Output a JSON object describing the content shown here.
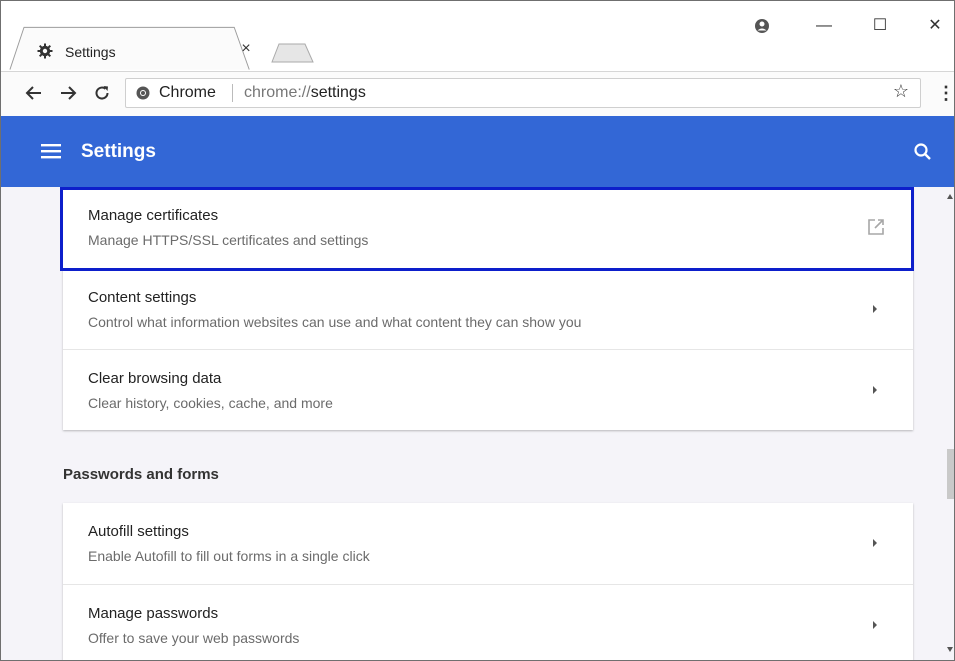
{
  "browser": {
    "tab": {
      "title": "Settings",
      "icon": "gear-icon",
      "close_label": "×"
    },
    "window_controls": {
      "profile_icon": "profile-icon",
      "minimize": "—",
      "maximize": "☐",
      "close": "✕"
    },
    "toolbar": {
      "back_icon": "back-arrow-icon",
      "forward_icon": "forward-arrow-icon",
      "reload_icon": "reload-icon",
      "omnibox": {
        "chip_label": "Chrome",
        "url_scheme": "chrome://",
        "url_path": "settings"
      },
      "bookmark_icon": "star-icon",
      "menu_icon": "more-vert-icon"
    }
  },
  "app": {
    "header": {
      "title": "Settings",
      "menu_icon": "hamburger-icon",
      "search_icon": "search-icon"
    },
    "colors": {
      "header_bg": "#3367d6",
      "focus_ring": "#0d1fcb",
      "content_bg": "#f5f4f9"
    },
    "advanced_card": [
      {
        "title": "Manage certificates",
        "subtitle": "Manage HTTPS/SSL certificates and settings",
        "action_icon": "open-external-icon",
        "focused": true
      },
      {
        "title": "Content settings",
        "subtitle": "Control what information websites can use and what content they can show you",
        "action_icon": "chevron-right-icon"
      },
      {
        "title": "Clear browsing data",
        "subtitle": "Clear history, cookies, cache, and more",
        "action_icon": "chevron-right-icon"
      }
    ],
    "passwords_section": {
      "title": "Passwords and forms",
      "items": [
        {
          "title": "Autofill settings",
          "subtitle": "Enable Autofill to fill out forms in a single click",
          "action_icon": "chevron-right-icon"
        },
        {
          "title": "Manage passwords",
          "subtitle": "Offer to save your web passwords",
          "action_icon": "chevron-right-icon"
        }
      ]
    }
  }
}
